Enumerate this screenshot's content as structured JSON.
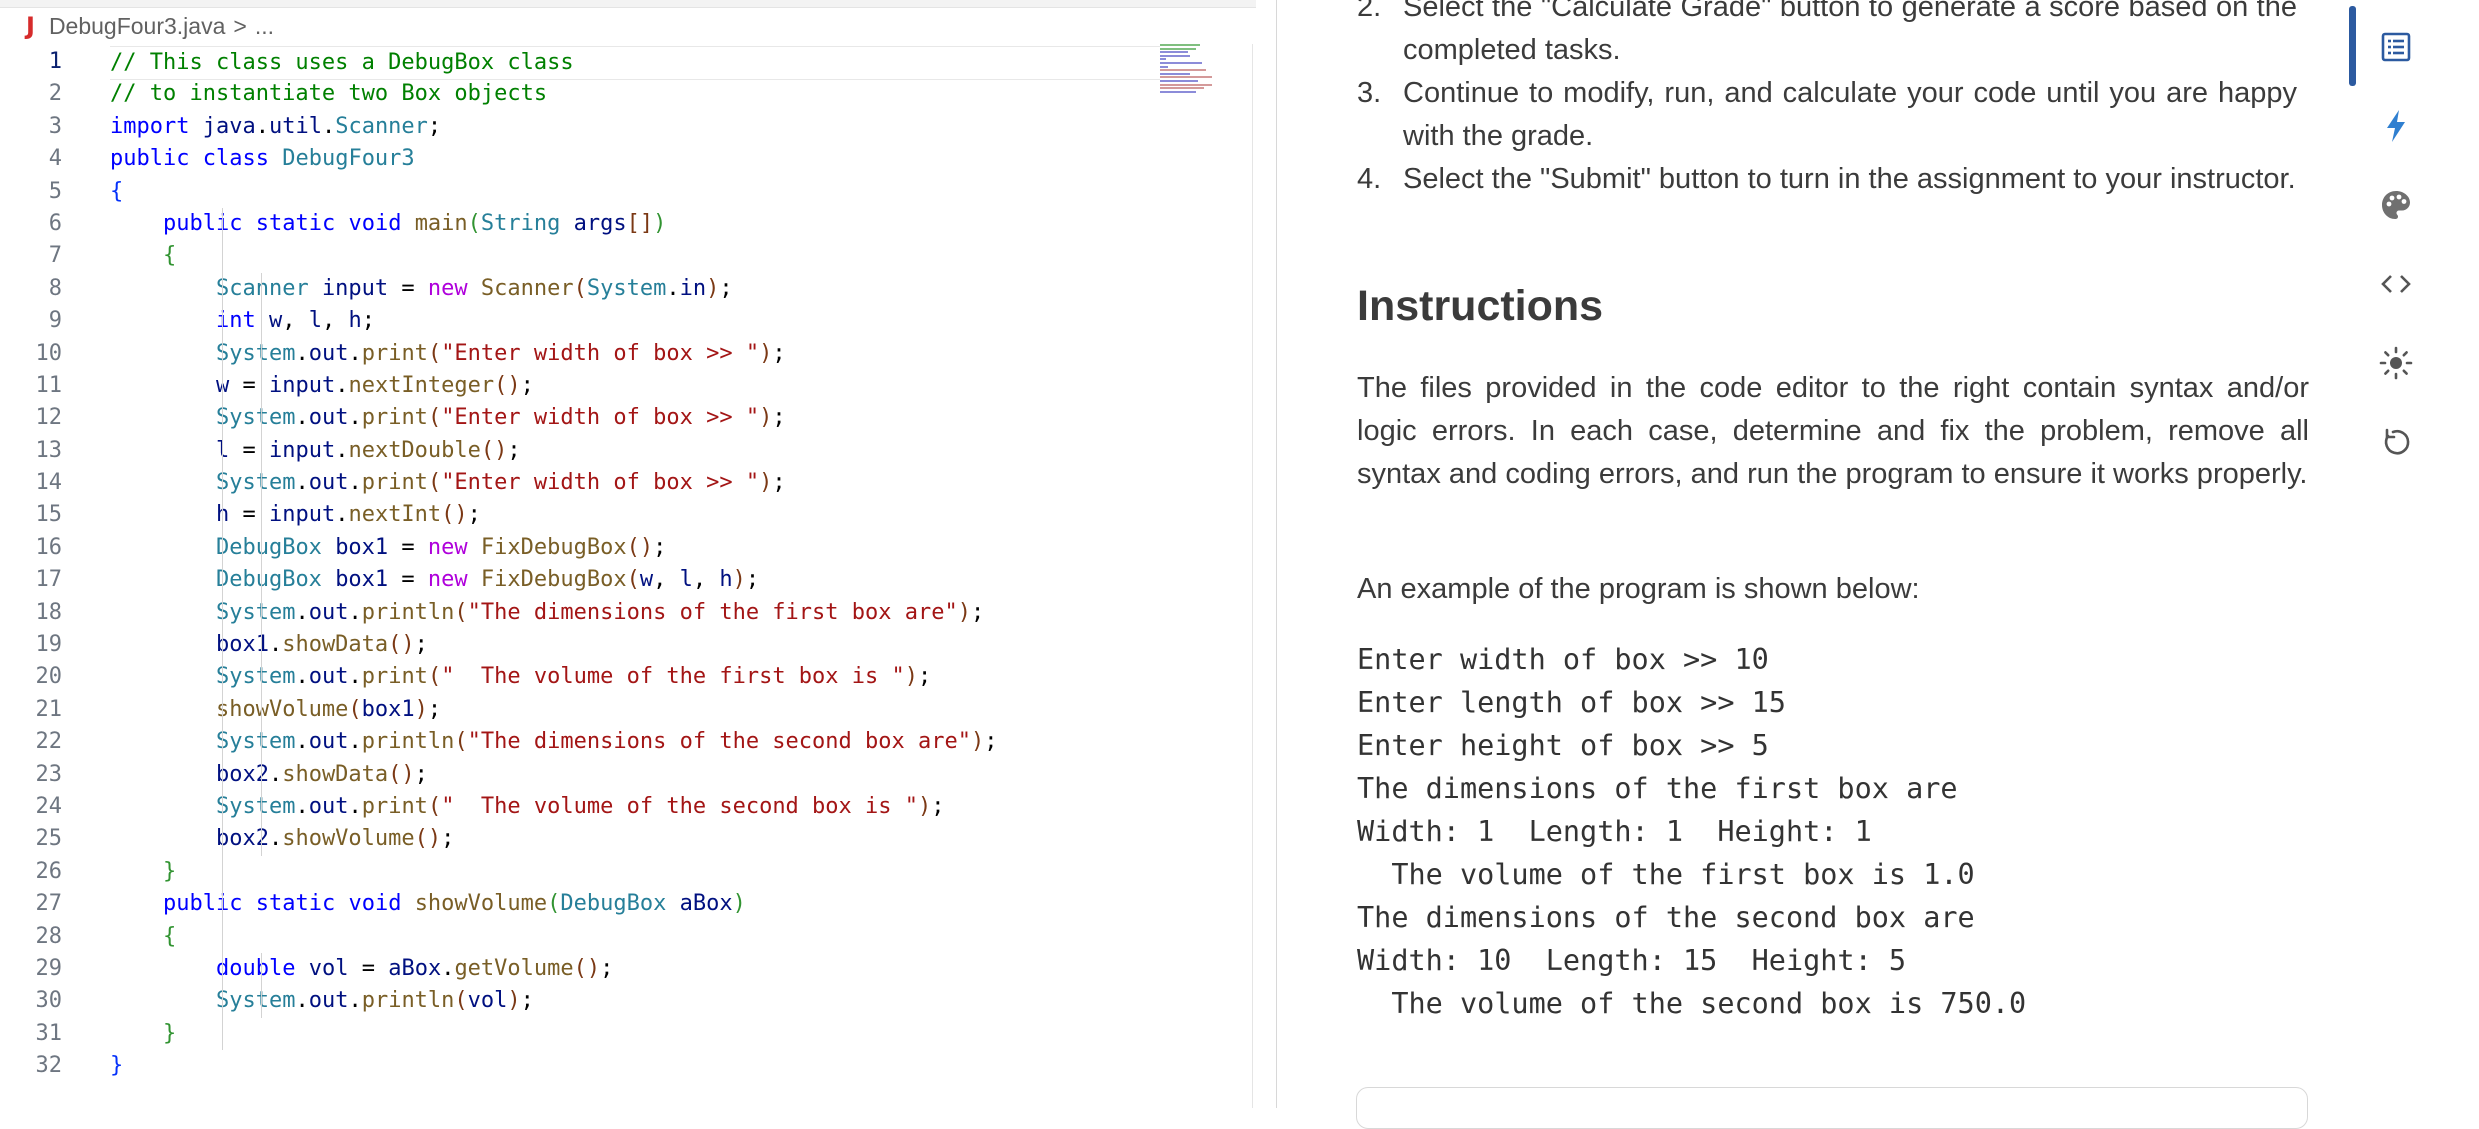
{
  "editor": {
    "file_icon": "J",
    "file_name": "DebugFour3.java",
    "breadcrumb_sep": ">",
    "breadcrumb_more": "...",
    "current_line": 1
  },
  "instructions": {
    "steps": [
      {
        "num": "2.",
        "text": "Select the \"Calculate Grade\" button to generate a score based on the completed tasks."
      },
      {
        "num": "3.",
        "text": "Continue to modify, run, and calculate your code until you are happy with the grade."
      },
      {
        "num": "4.",
        "text": "Select the \"Submit\" button to turn in the assignment to your instructor."
      }
    ],
    "heading": "Instructions",
    "paragraph": "The files provided in the code editor to the right contain syntax and/or logic errors. In each case, determine and fix the problem, remove all syntax and coding errors, and run the program to ensure it works properly.",
    "example_intro": "An example of the program is shown below:",
    "example_lines": [
      "Enter width of box >> 10",
      "Enter length of box >> 15",
      "Enter height of box >> 5",
      "The dimensions of the first box are",
      "Width: 1  Length: 1  Height: 1",
      "  The volume of the first box is 1.0",
      "The dimensions of the second box are",
      "Width: 10  Length: 15  Height: 5",
      "  The volume of the second box is 750.0"
    ]
  },
  "toolbar": {
    "icons": [
      "list-icon",
      "lightning-icon",
      "palette-icon",
      "code-icon",
      "sun-icon",
      "reset-icon"
    ],
    "active": "list-icon",
    "accent": "#2c5aa0"
  },
  "colors": {
    "keyword": "#0000ff",
    "type": "#267f99",
    "string": "#a31515",
    "comment": "#008000",
    "function": "#795e26",
    "variable": "#001080",
    "java_icon": "#d62b2b"
  }
}
